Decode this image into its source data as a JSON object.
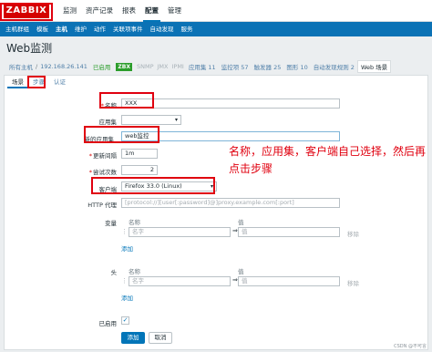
{
  "logo": "ZABBIX",
  "top_menu": [
    {
      "label": "监测"
    },
    {
      "label": "资产记录"
    },
    {
      "label": "报表"
    },
    {
      "label": "配置"
    },
    {
      "label": "管理"
    }
  ],
  "sub_menu": [
    {
      "label": "主机群组"
    },
    {
      "label": "模板"
    },
    {
      "label": "主机"
    },
    {
      "label": "维护"
    },
    {
      "label": "动作"
    },
    {
      "label": "关联项事件"
    },
    {
      "label": "自动发现"
    },
    {
      "label": "服务"
    }
  ],
  "page_title": "Web监测",
  "breadcrumb": {
    "all_hosts": "所有主机",
    "host": "192.168.26.141",
    "enabled": "已启用",
    "zbx": "ZBX",
    "snmp": "SNMP",
    "jmx": "JMX",
    "ipmi": "IPMI",
    "apps": "应用集 11",
    "items": "监控项 57",
    "triggers": "触发器 25",
    "graphs": "图形 10",
    "discovery": "自动发现规则 2",
    "web": "Web 场景"
  },
  "tabs": [
    {
      "label": "场景"
    },
    {
      "label": "步骤"
    },
    {
      "label": "认证"
    }
  ],
  "form": {
    "name_label": "名称",
    "name_value": "XXX",
    "app_label": "应用集",
    "app_value": "",
    "new_app_label": "新的应用集",
    "new_app_value": "web监控",
    "interval_label": "更新间隔",
    "interval_value": "1m",
    "attempts_label": "尝试次数",
    "attempts_value": "2",
    "agent_label": "客户端",
    "agent_value": "Firefox 33.0 (Linux)",
    "proxy_label": "HTTP 代理",
    "proxy_placeholder": "[protocol://][user[:password]@]proxy.example.com[:port]",
    "vars_label": "变量",
    "headers_label": "头",
    "col_name": "名称",
    "col_value": "值",
    "name_placeholder": "名字",
    "value_placeholder": "值",
    "remove": "移除",
    "add_link": "添加",
    "enabled_label": "已启用",
    "enabled_checked": "✓",
    "add_button": "添加",
    "cancel_button": "取消"
  },
  "annotation": "名称，应用集，客户端自己选择，然后再点击步骤",
  "watermark": "CSDN @不可言"
}
